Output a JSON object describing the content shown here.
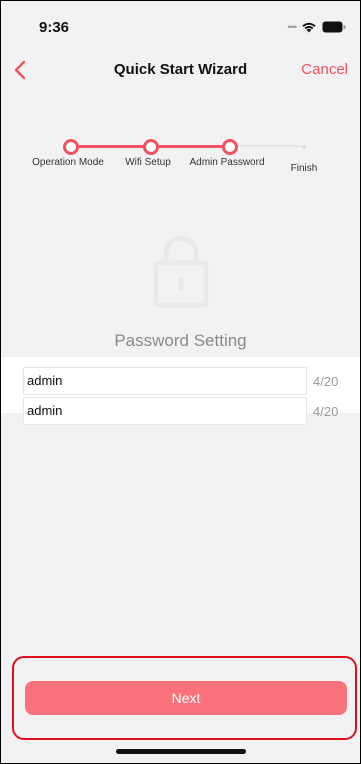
{
  "status_bar": {
    "time": "9:36",
    "signal_icon": "signal-dots-icon",
    "wifi_icon": "wifi-icon",
    "battery_icon": "battery-icon"
  },
  "nav": {
    "back_icon": "chevron-left-icon",
    "title": "Quick Start Wizard",
    "cancel_label": "Cancel"
  },
  "stepper": {
    "steps": [
      {
        "label": "Operation Mode",
        "state": "done"
      },
      {
        "label": "Wifi Setup",
        "state": "done"
      },
      {
        "label": "Admin Password",
        "state": "current"
      },
      {
        "label": "Finish",
        "state": "pending"
      }
    ]
  },
  "section": {
    "icon": "lock-icon",
    "title": "Password Setting"
  },
  "fields": [
    {
      "value": "admin",
      "counter": "4/20"
    },
    {
      "value": "admin",
      "counter": "4/20"
    }
  ],
  "footer": {
    "next_label": "Next"
  },
  "colors": {
    "accent": "#f0525f",
    "button": "#f9717b",
    "highlight": "#e0101b",
    "background": "#f2f2f4"
  }
}
